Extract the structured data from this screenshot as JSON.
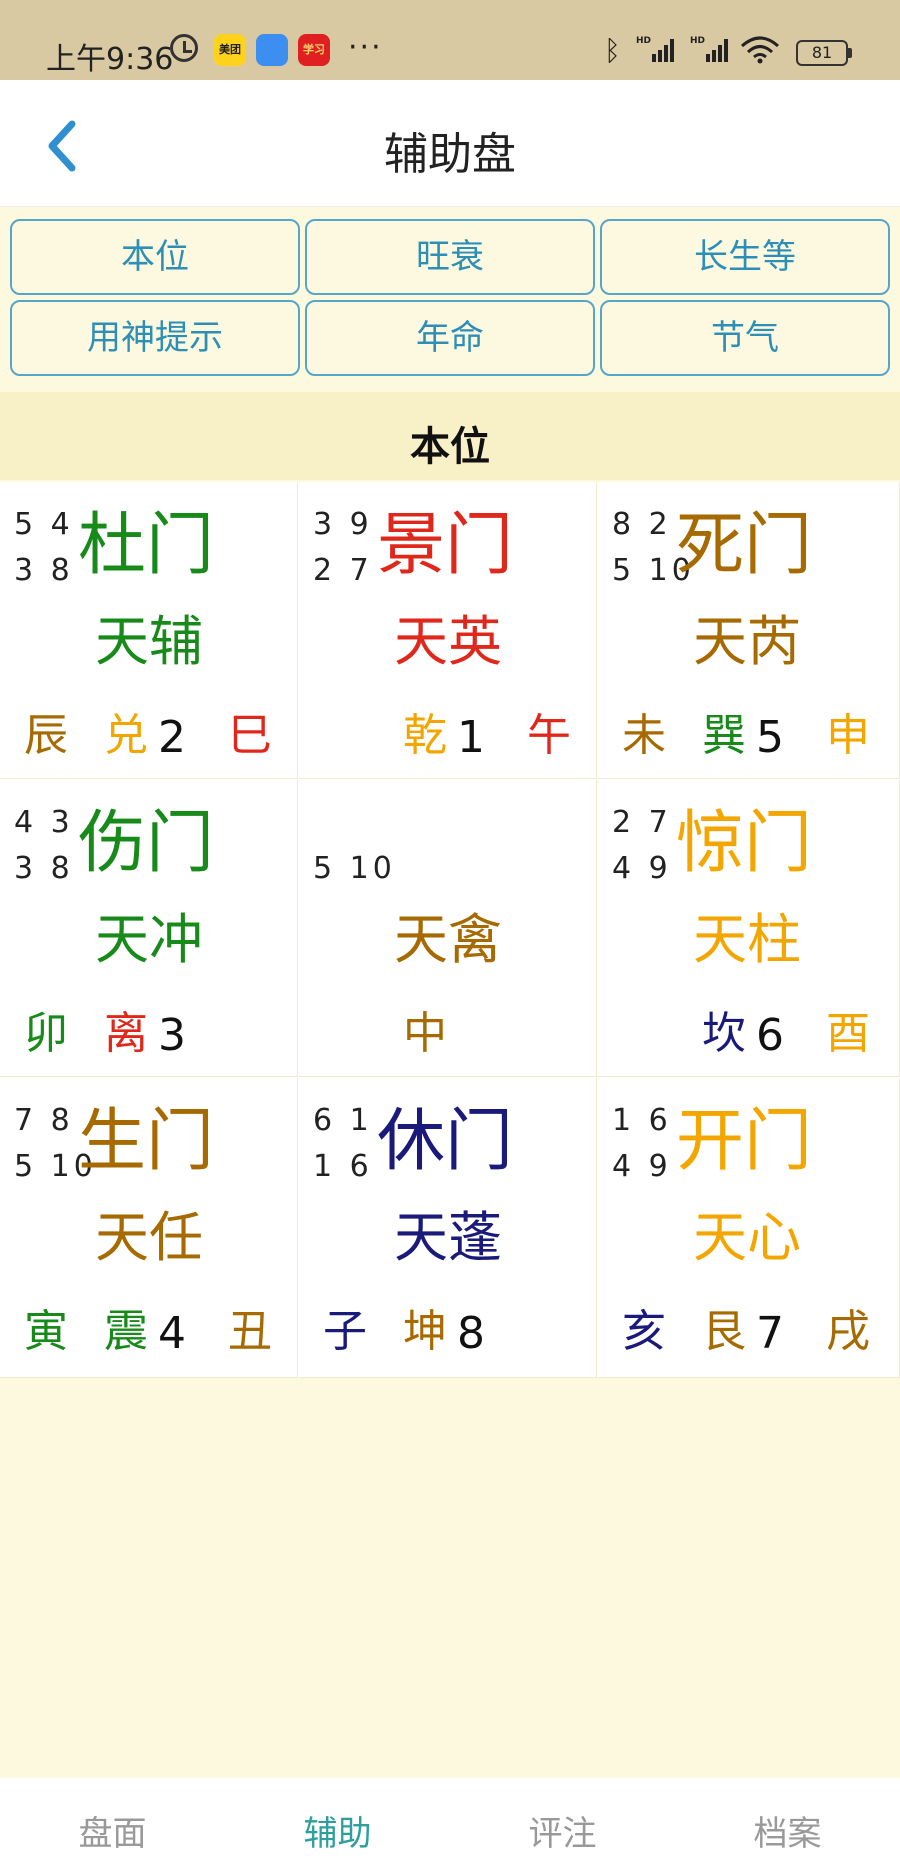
{
  "status_bar": {
    "time": "上午9:36",
    "apps": [
      "美团",
      "",
      "学习"
    ],
    "more": "···",
    "battery": "81"
  },
  "header": {
    "title": "辅助盘"
  },
  "buttons": [
    "本位",
    "旺衰",
    "长生等",
    "用神提示",
    "年命",
    "节气"
  ],
  "section_title": "本位",
  "colors": {
    "green": "#178a1a",
    "red": "#e0271b",
    "brown": "#a66a00",
    "orange": "#f3a600",
    "navy": "#1a1a7a",
    "dark": "#111111",
    "accent": "#2f9f9e",
    "button_border": "#57a5c8"
  },
  "grid": [
    {
      "nums": "5 4\n3 8",
      "gate": "杜门",
      "gate_color": "green",
      "star": "天辅",
      "star_color": "green",
      "left": "辰",
      "left_color": "brown",
      "mid": "兑",
      "mid_color": "orange",
      "num": "2",
      "right": "巳",
      "right_color": "red"
    },
    {
      "nums": "3 9\n2 7",
      "gate": "景门",
      "gate_color": "red",
      "star": "天英",
      "star_color": "red",
      "left": "",
      "left_color": "brown",
      "mid": "乾",
      "mid_color": "orange",
      "num": "1",
      "right": "午",
      "right_color": "red"
    },
    {
      "nums": "8 2\n5 10",
      "gate": "死门",
      "gate_color": "brown",
      "star": "天芮",
      "star_color": "brown",
      "left": "未",
      "left_color": "brown",
      "mid": "巽",
      "mid_color": "green",
      "num": "5",
      "right": "申",
      "right_color": "orange"
    },
    {
      "nums": "4 3\n3 8",
      "gate": "伤门",
      "gate_color": "green",
      "star": "天冲",
      "star_color": "green",
      "left": "卯",
      "left_color": "green",
      "mid": "离",
      "mid_color": "red",
      "num": "3",
      "right": "",
      "right_color": "brown"
    },
    {
      "nums": "\n5 10",
      "gate": "",
      "gate_color": "brown",
      "star": "天禽",
      "star_color": "brown",
      "left": "",
      "left_color": "brown",
      "mid": "中",
      "mid_color": "brown",
      "num": "",
      "right": "",
      "right_color": "brown"
    },
    {
      "nums": "2 7\n4 9",
      "gate": "惊门",
      "gate_color": "orange",
      "star": "天柱",
      "star_color": "orange",
      "left": "",
      "left_color": "brown",
      "mid": "坎",
      "mid_color": "navy",
      "num": "6",
      "right": "酉",
      "right_color": "orange"
    },
    {
      "nums": "7 8\n5 10",
      "gate": "生门",
      "gate_color": "brown",
      "star": "天任",
      "star_color": "brown",
      "left": "寅",
      "left_color": "green",
      "mid": "震",
      "mid_color": "green",
      "num": "4",
      "right": "丑",
      "right_color": "brown"
    },
    {
      "nums": "6 1\n1 6",
      "gate": "休门",
      "gate_color": "navy",
      "star": "天蓬",
      "star_color": "navy",
      "left": "子",
      "left_color": "navy",
      "mid": "坤",
      "mid_color": "brown",
      "num": "8",
      "right": "",
      "right_color": "brown"
    },
    {
      "nums": "1 6\n4 9",
      "gate": "开门",
      "gate_color": "orange",
      "star": "天心",
      "star_color": "orange",
      "left": "亥",
      "left_color": "navy",
      "mid": "艮",
      "mid_color": "brown",
      "num": "7",
      "right": "戌",
      "right_color": "brown"
    }
  ],
  "bottom_nav": [
    {
      "label": "盘面",
      "active": false
    },
    {
      "label": "辅助",
      "active": true
    },
    {
      "label": "评注",
      "active": false
    },
    {
      "label": "档案",
      "active": false
    }
  ]
}
